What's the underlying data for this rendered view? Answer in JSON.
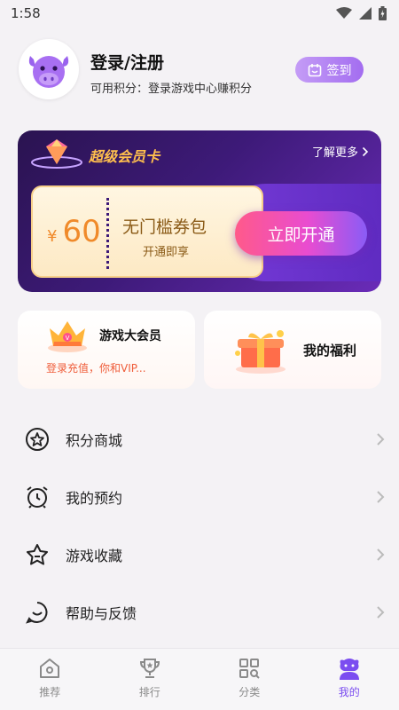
{
  "status_bar": {
    "time": "1:58"
  },
  "profile": {
    "name": "登录/注册",
    "points_label": "可用积分：",
    "points_hint": "登录游戏中心赚积分",
    "signin_label": "签到"
  },
  "vip_card": {
    "title": "超级会员卡",
    "more_label": "了解更多",
    "currency": "¥",
    "price": "60",
    "package_name": "无门槛券包",
    "package_hint": "开通即享",
    "open_button": "立即开通"
  },
  "benefits": {
    "game_member": {
      "title": "游戏大会员",
      "subtitle": "登录充值，你和VIP..."
    },
    "welfare": {
      "title": "我的福利"
    }
  },
  "menu": {
    "items": [
      {
        "label": "积分商城",
        "icon": "star-circle-icon"
      },
      {
        "label": "我的预约",
        "icon": "alarm-clock-icon"
      },
      {
        "label": "游戏收藏",
        "icon": "star-outline-icon"
      },
      {
        "label": "帮助与反馈",
        "icon": "smile-chat-icon"
      }
    ]
  },
  "bottom_nav": {
    "tabs": [
      {
        "label": "推荐",
        "icon": "home-icon"
      },
      {
        "label": "排行",
        "icon": "trophy-icon"
      },
      {
        "label": "分类",
        "icon": "category-grid-icon"
      },
      {
        "label": "我的",
        "icon": "profile-icon",
        "active": true
      }
    ]
  },
  "colors": {
    "accent": "#7b4df0",
    "vip_bg": "#3d1a78",
    "price": "#f08a2a",
    "open_button": "#e94cd0"
  }
}
